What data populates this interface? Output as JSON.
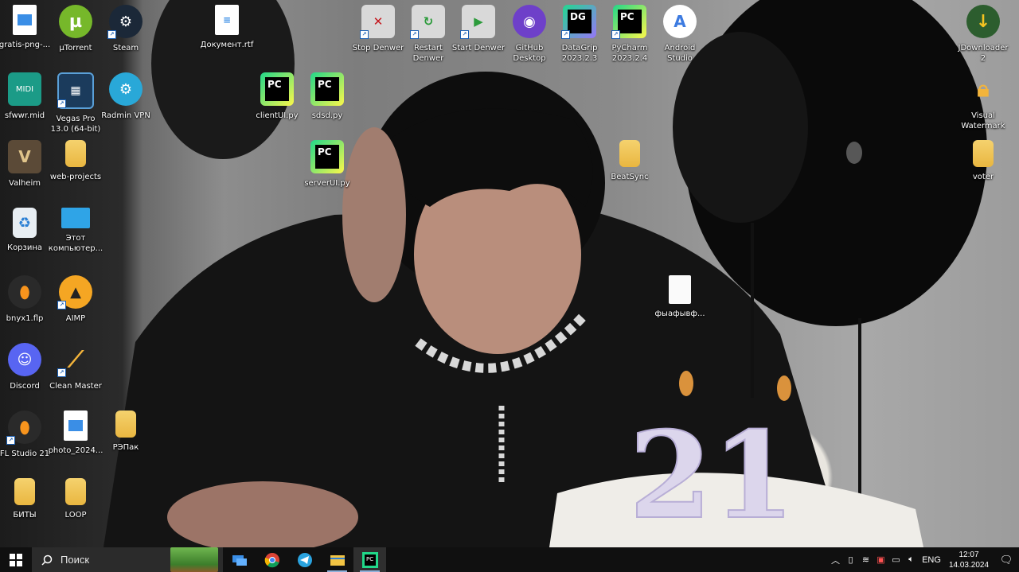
{
  "desktop": {
    "icons": [
      {
        "label": "gratis-png-...",
        "icon": "image-file-icon"
      },
      {
        "label": "µTorrent",
        "icon": "utorrent-icon"
      },
      {
        "label": "Steam",
        "icon": "steam-icon"
      },
      {
        "label": "Документ.rtf",
        "icon": "rtf-document-icon"
      },
      {
        "label": "Stop Denwer",
        "icon": "stop-denwer-icon"
      },
      {
        "label": "Restart\nDenwer",
        "icon": "restart-denwer-icon"
      },
      {
        "label": "Start Denwer",
        "icon": "start-denwer-icon"
      },
      {
        "label": "GitHub\nDesktop",
        "icon": "github-desktop-icon"
      },
      {
        "label": "DataGrip\n2023.2.3",
        "icon": "datagrip-icon"
      },
      {
        "label": "PyCharm\n2023.2.4",
        "icon": "pycharm-icon"
      },
      {
        "label": "Android\nStudio",
        "icon": "android-studio-icon"
      },
      {
        "label": "JDownloader\n2",
        "icon": "jdownloader-icon"
      },
      {
        "label": "sfwwr.mid",
        "icon": "midi-file-icon"
      },
      {
        "label": "Vegas Pro\n13.0 (64-bit)",
        "icon": "vegas-pro-icon"
      },
      {
        "label": "Radmin VPN",
        "icon": "radmin-vpn-icon"
      },
      {
        "label": "clientUI.py",
        "icon": "python-file-icon"
      },
      {
        "label": "sdsd.py",
        "icon": "python-file-icon"
      },
      {
        "label": "Visual\nWatermark",
        "icon": "lock-icon"
      },
      {
        "label": "Valheim",
        "icon": "valheim-icon"
      },
      {
        "label": "web-projects",
        "icon": "folder-icon"
      },
      {
        "label": "serverUI.py",
        "icon": "python-file-icon"
      },
      {
        "label": "BeatSync",
        "icon": "folder-icon"
      },
      {
        "label": "voter",
        "icon": "folder-icon"
      },
      {
        "label": "Корзина",
        "icon": "recycle-bin-icon"
      },
      {
        "label": "Этот\nкомпьютер...",
        "icon": "this-pc-icon"
      },
      {
        "label": "bnyx1.flp",
        "icon": "fl-studio-icon"
      },
      {
        "label": "AIMP",
        "icon": "aimp-icon"
      },
      {
        "label": "фыафывф...",
        "icon": "blank-file-icon"
      },
      {
        "label": "Discord",
        "icon": "discord-icon"
      },
      {
        "label": "Clean Master",
        "icon": "broom-icon"
      },
      {
        "label": "FL Studio 21",
        "icon": "fl-studio-icon"
      },
      {
        "label": "photo_2024...",
        "icon": "image-file-icon"
      },
      {
        "label": "РЭПак",
        "icon": "folder-icon"
      },
      {
        "label": "БИТЫ",
        "icon": "folder-icon"
      },
      {
        "label": "LOOP",
        "icon": "folder-icon"
      }
    ],
    "wallpaper_candle_text": "21"
  },
  "taskbar": {
    "search_placeholder": "Поиск",
    "apps": [
      "task-view-icon",
      "chrome-icon",
      "telegram-icon",
      "file-explorer-icon",
      "pycharm-icon"
    ],
    "tray": {
      "language": "ENG",
      "time": "12:07",
      "date": "14.03.2024"
    }
  },
  "colors": {
    "taskbar_bg": "#101010",
    "search_bg": "#2b2b2b",
    "pycharm_green": "#21d789",
    "folder_yellow": "#f0c453"
  }
}
